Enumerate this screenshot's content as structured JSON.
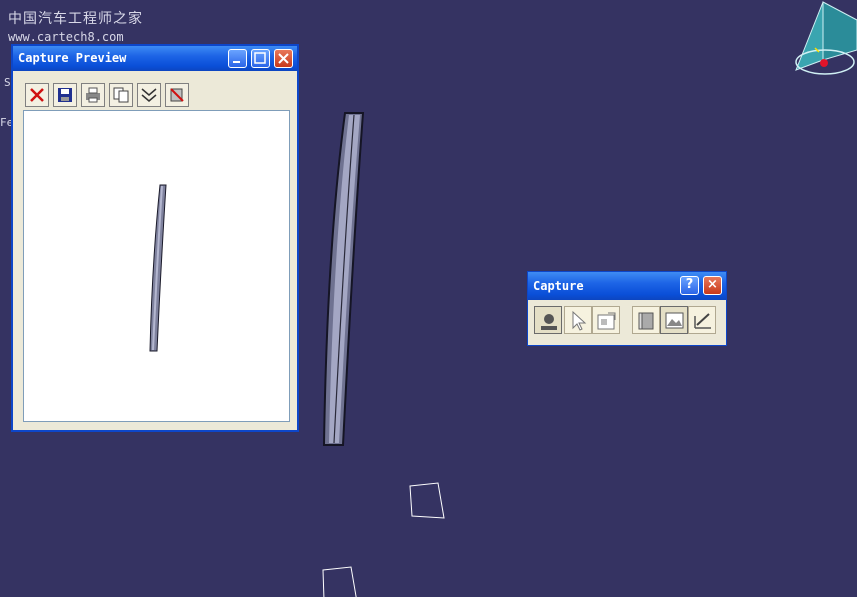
{
  "watermark": {
    "chinese": "中国汽车工程师之家",
    "url": "www.cartech8.com"
  },
  "edge_letters": [
    "S",
    "Fe"
  ],
  "preview_window": {
    "title": "Capture Preview",
    "toolbar": [
      "close-icon",
      "save-icon",
      "print-icon",
      "copy-icon",
      "options-icon",
      "delete-icon"
    ]
  },
  "capture_window": {
    "title": "Capture",
    "help_label": "?",
    "close_label": "×",
    "tools": [
      "capture-icon",
      "select-icon",
      "options-icon",
      "album-icon",
      "image-icon",
      "record-icon"
    ]
  },
  "colors": {
    "background": "#353362",
    "titlebar": "#0a4fd8",
    "part": "#7c7f9a"
  }
}
